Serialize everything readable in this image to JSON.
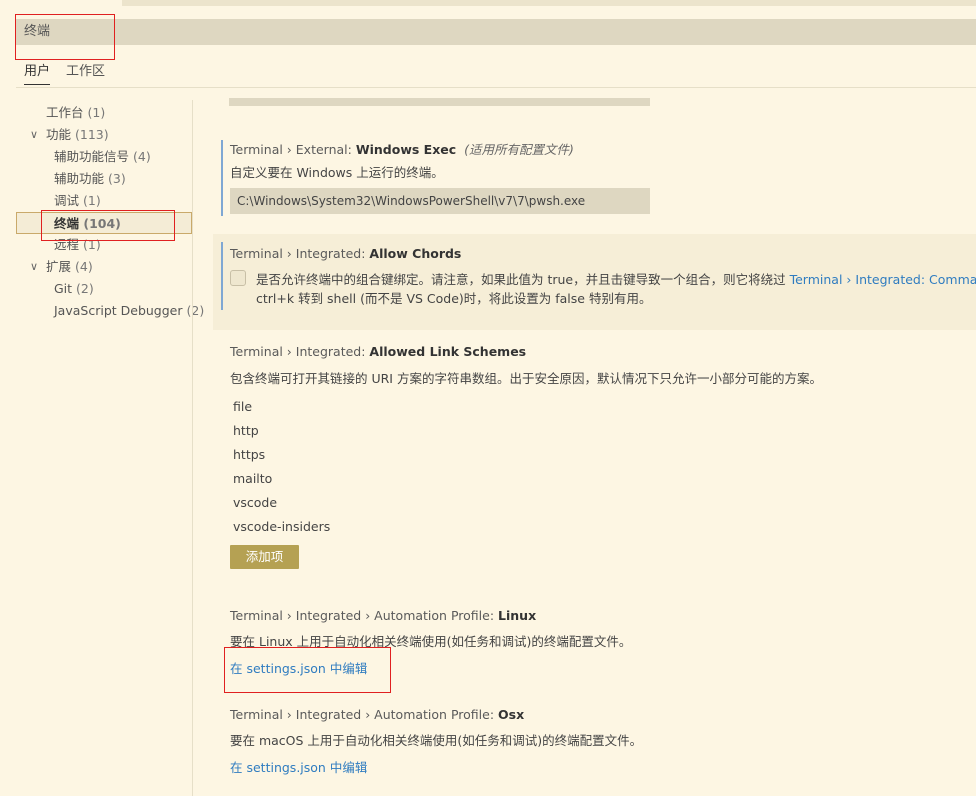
{
  "search": {
    "value": "终端"
  },
  "scope_tabs": [
    {
      "label": "用户"
    },
    {
      "label": "工作区"
    }
  ],
  "tree": [
    {
      "label": "工作台",
      "count": "(1)"
    },
    {
      "label": "功能",
      "count": "(113)"
    },
    {
      "label": "辅助功能信号",
      "count": "(4)"
    },
    {
      "label": "辅助功能",
      "count": "(3)"
    },
    {
      "label": "调试",
      "count": "(1)"
    },
    {
      "label": "终端",
      "count": "(104)"
    },
    {
      "label": "远程",
      "count": "(1)"
    },
    {
      "label": "扩展",
      "count": "(4)"
    },
    {
      "label": "Git",
      "count": "(2)"
    },
    {
      "label": "JavaScript Debugger",
      "count": "(2)"
    }
  ],
  "settings": {
    "windows_exec": {
      "prefix": "Terminal › External: ",
      "name": "Windows Exec",
      "scope_note": "(适用所有配置文件)",
      "description": "自定义要在 Windows 上运行的终端。",
      "value": "C:\\Windows\\System32\\WindowsPowerShell\\v7\\7\\pwsh.exe"
    },
    "allow_chords": {
      "prefix": "Terminal › Integrated: ",
      "name": "Allow Chords",
      "description_1": "是否允许终端中的组合键绑定。请注意，如果此值为 true，并且击键导致一个组合，则它将绕过 ",
      "link": "Terminal › Integrated: Comma",
      "description_2": "ctrl+k 转到 shell (而不是 VS Code)时，将此设置为 false 特别有用。"
    },
    "allowed_link_schemes": {
      "prefix": "Terminal › Integrated: ",
      "name": "Allowed Link Schemes",
      "description": "包含终端可打开其链接的 URI 方案的字符串数组。出于安全原因，默认情况下只允许一小部分可能的方案。",
      "items": [
        "file",
        "http",
        "https",
        "mailto",
        "vscode",
        "vscode-insiders"
      ],
      "add_button": "添加项"
    },
    "automation_linux": {
      "prefix": "Terminal › Integrated › Automation Profile: ",
      "name": "Linux",
      "description": "要在 Linux 上用于自动化相关终端使用(如任务和调试)的终端配置文件。",
      "edit_link": "在 settings.json 中编辑"
    },
    "automation_osx": {
      "prefix": "Terminal › Integrated › Automation Profile: ",
      "name": "Osx",
      "description": "要在 macOS 上用于自动化相关终端使用(如任务和调试)的终端配置文件。",
      "edit_link": "在 settings.json 中编辑"
    }
  }
}
